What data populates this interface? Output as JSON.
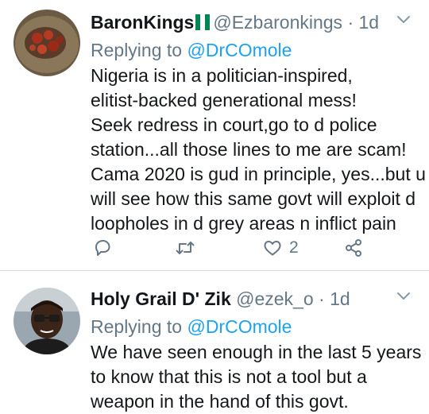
{
  "tweets": [
    {
      "name": "BaronKings",
      "handle": "@Ezbaronkings",
      "separator": "·",
      "time": "1d",
      "replying_prefix": "Replying to",
      "replying_to": "@DrCOmole",
      "lines": [
        "Nigeria is in a politician-inspired,",
        "elitist-backed generational mess!",
        "Seek redress in court,go to d police",
        "station...all those lines to me are scam!",
        "Cama 2020 is gud in principle, yes...but u",
        "will see how this same govt will exploit d",
        "loopholes in d grey areas n inflict pain"
      ],
      "like_count": "2"
    },
    {
      "name": "Holy Grail D' Zik",
      "handle": "@ezek_o",
      "separator": "·",
      "time": "1d",
      "replying_prefix": "Replying to",
      "replying_to": "@DrCOmole",
      "lines": [
        "We have seen enough in the last 5 years",
        "to know that this is not a tool but a",
        "weapon in the hand of this govt."
      ]
    }
  ],
  "colors": {
    "text": "#14171a",
    "muted": "#657786",
    "link": "#1da1f2",
    "divider": "#d9dde1",
    "flag_green": "#008751"
  },
  "icons": [
    "reply-icon",
    "retweet-icon",
    "like-icon",
    "share-icon",
    "chevron-down-icon"
  ]
}
